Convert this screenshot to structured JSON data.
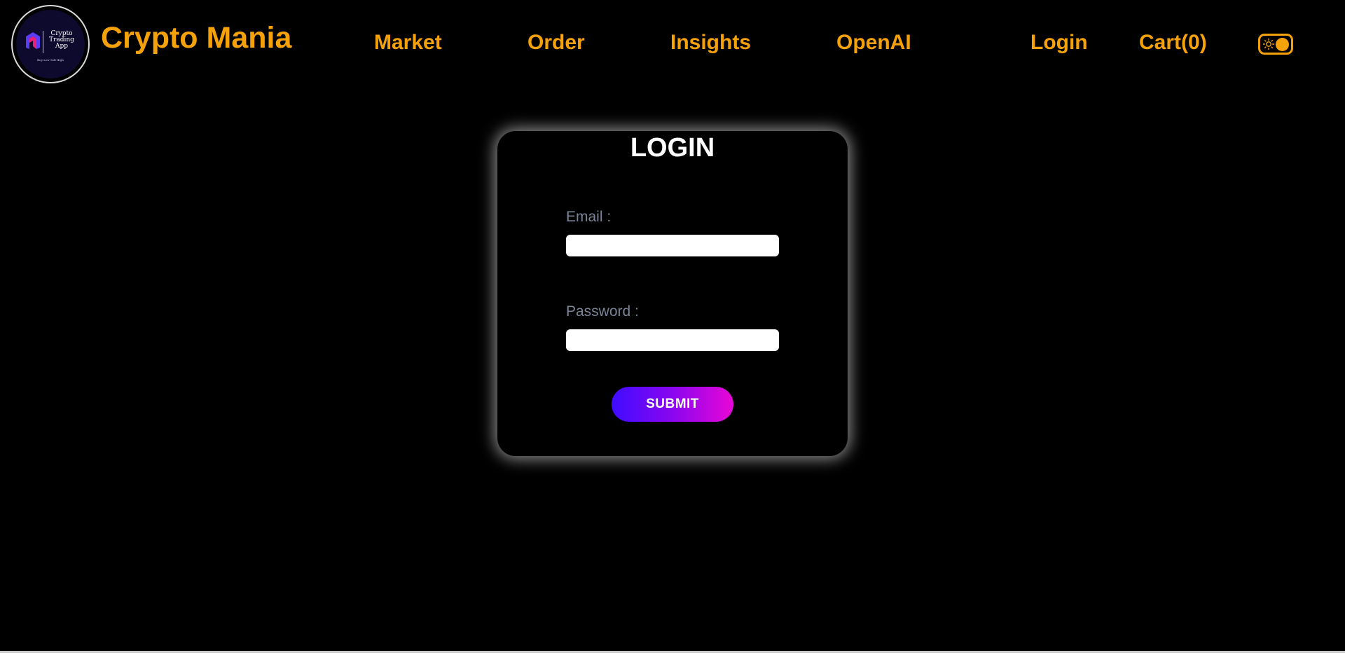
{
  "header": {
    "logo": {
      "text_lines": [
        "Crypto",
        "Trading",
        "App"
      ],
      "tagline": "Buy Low Sell High",
      "icon": "crypto-app-logo-icon"
    },
    "brand": "Crypto Mania",
    "nav": {
      "market": "Market",
      "order": "Order",
      "insights": "Insights",
      "openai": "OpenAI",
      "login": "Login",
      "cart": "Cart(0)"
    },
    "theme_toggle": {
      "icon": "sun-icon",
      "state": "dark"
    }
  },
  "login_card": {
    "title": "LOGIN",
    "email_label": "Email :",
    "email_value": "",
    "password_label": "Password :",
    "password_value": "",
    "submit_label": "SUBMIT"
  },
  "colors": {
    "accent": "#f5a10a",
    "background": "#000000",
    "label": "#7b8499",
    "button_gradient_start": "#3f0cff",
    "button_gradient_end": "#e806d6"
  }
}
